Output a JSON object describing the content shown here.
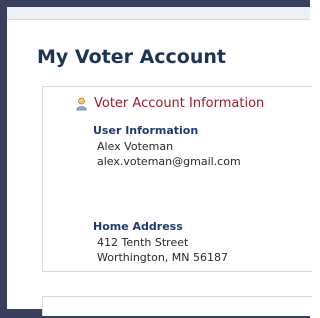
{
  "page": {
    "title": "My Voter Account"
  },
  "section": {
    "title": "Voter Account Information",
    "icon": "user-icon"
  },
  "user_information": {
    "label": "User Information",
    "name": "Alex Voteman",
    "email": "alex.voteman@gmail.com"
  },
  "home_address": {
    "label": "Home Address",
    "street": "412 Tenth Street",
    "city_state_zip": "Worthington, MN 56187"
  },
  "colors": {
    "frame": "#3a3f5e",
    "page_title": "#1d3453",
    "section_title": "#9b1c2e",
    "labels": "#1f3a73"
  }
}
